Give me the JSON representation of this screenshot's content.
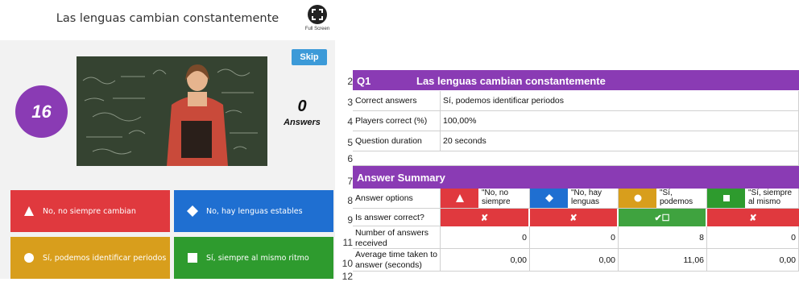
{
  "quiz": {
    "title": "Las lenguas cambian constantemente",
    "fullscreen_label": "Full Screen",
    "skip_label": "Skip",
    "timer": "16",
    "answers_count": "0",
    "answers_label": "Answers",
    "options": [
      {
        "label": "No, no siempre cambian",
        "color": "#e0393e",
        "icon": "triangle-icon"
      },
      {
        "label": "No, hay lenguas estables",
        "color": "#1f6fd1",
        "icon": "diamond-icon"
      },
      {
        "label": "Sí, podemos identificar periodos",
        "color": "#d89e1c",
        "icon": "circle-icon"
      },
      {
        "label": "Sí, siempre al mismo ritmo",
        "color": "#2e9b2e",
        "icon": "square-icon"
      }
    ]
  },
  "sheet": {
    "row_numbers": [
      "2",
      "3",
      "4",
      "5",
      "6",
      "7",
      "8",
      "9",
      "10",
      "11",
      "12"
    ],
    "q_id": "Q1",
    "q_title": "Las lenguas cambian constantemente",
    "correct_answers_label": "Correct answers",
    "correct_answers_value": "Sí, podemos identificar periodos",
    "players_correct_label": "Players correct (%)",
    "players_correct_value": "100,00%",
    "duration_label": "Question duration",
    "duration_value": "20 seconds",
    "summary_title": "Answer Summary",
    "answer_options_label": "Answer options",
    "option_texts": [
      "\"No, no siempre",
      "\"No, hay lenguas",
      "\"Sí, podemos",
      "\"Sí, siempre al mismo"
    ],
    "is_correct_label": "Is answer correct?",
    "correct_marks": [
      "✘",
      "✘",
      "✔☐",
      "✘"
    ],
    "received_label": "Number of answers received",
    "received_values": [
      "0",
      "0",
      "8",
      "0"
    ],
    "avg_time_label": "Average time taken to answer (seconds)",
    "avg_time_values": [
      "0,00",
      "0,00",
      "11,06",
      "0,00"
    ]
  }
}
